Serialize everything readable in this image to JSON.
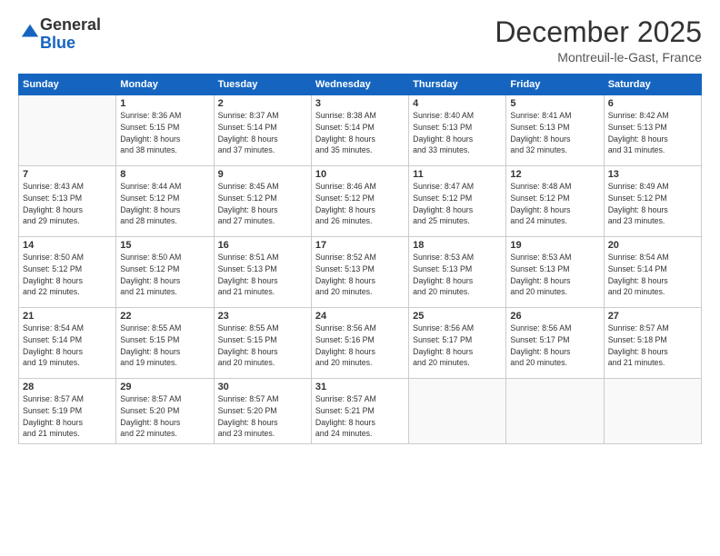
{
  "logo": {
    "general": "General",
    "blue": "Blue"
  },
  "header": {
    "month": "December 2025",
    "location": "Montreuil-le-Gast, France"
  },
  "weekdays": [
    "Sunday",
    "Monday",
    "Tuesday",
    "Wednesday",
    "Thursday",
    "Friday",
    "Saturday"
  ],
  "weeks": [
    [
      {
        "day": "",
        "info": ""
      },
      {
        "day": "1",
        "info": "Sunrise: 8:36 AM\nSunset: 5:15 PM\nDaylight: 8 hours\nand 38 minutes."
      },
      {
        "day": "2",
        "info": "Sunrise: 8:37 AM\nSunset: 5:14 PM\nDaylight: 8 hours\nand 37 minutes."
      },
      {
        "day": "3",
        "info": "Sunrise: 8:38 AM\nSunset: 5:14 PM\nDaylight: 8 hours\nand 35 minutes."
      },
      {
        "day": "4",
        "info": "Sunrise: 8:40 AM\nSunset: 5:13 PM\nDaylight: 8 hours\nand 33 minutes."
      },
      {
        "day": "5",
        "info": "Sunrise: 8:41 AM\nSunset: 5:13 PM\nDaylight: 8 hours\nand 32 minutes."
      },
      {
        "day": "6",
        "info": "Sunrise: 8:42 AM\nSunset: 5:13 PM\nDaylight: 8 hours\nand 31 minutes."
      }
    ],
    [
      {
        "day": "7",
        "info": "Sunrise: 8:43 AM\nSunset: 5:13 PM\nDaylight: 8 hours\nand 29 minutes."
      },
      {
        "day": "8",
        "info": "Sunrise: 8:44 AM\nSunset: 5:12 PM\nDaylight: 8 hours\nand 28 minutes."
      },
      {
        "day": "9",
        "info": "Sunrise: 8:45 AM\nSunset: 5:12 PM\nDaylight: 8 hours\nand 27 minutes."
      },
      {
        "day": "10",
        "info": "Sunrise: 8:46 AM\nSunset: 5:12 PM\nDaylight: 8 hours\nand 26 minutes."
      },
      {
        "day": "11",
        "info": "Sunrise: 8:47 AM\nSunset: 5:12 PM\nDaylight: 8 hours\nand 25 minutes."
      },
      {
        "day": "12",
        "info": "Sunrise: 8:48 AM\nSunset: 5:12 PM\nDaylight: 8 hours\nand 24 minutes."
      },
      {
        "day": "13",
        "info": "Sunrise: 8:49 AM\nSunset: 5:12 PM\nDaylight: 8 hours\nand 23 minutes."
      }
    ],
    [
      {
        "day": "14",
        "info": "Sunrise: 8:50 AM\nSunset: 5:12 PM\nDaylight: 8 hours\nand 22 minutes."
      },
      {
        "day": "15",
        "info": "Sunrise: 8:50 AM\nSunset: 5:12 PM\nDaylight: 8 hours\nand 21 minutes."
      },
      {
        "day": "16",
        "info": "Sunrise: 8:51 AM\nSunset: 5:13 PM\nDaylight: 8 hours\nand 21 minutes."
      },
      {
        "day": "17",
        "info": "Sunrise: 8:52 AM\nSunset: 5:13 PM\nDaylight: 8 hours\nand 20 minutes."
      },
      {
        "day": "18",
        "info": "Sunrise: 8:53 AM\nSunset: 5:13 PM\nDaylight: 8 hours\nand 20 minutes."
      },
      {
        "day": "19",
        "info": "Sunrise: 8:53 AM\nSunset: 5:13 PM\nDaylight: 8 hours\nand 20 minutes."
      },
      {
        "day": "20",
        "info": "Sunrise: 8:54 AM\nSunset: 5:14 PM\nDaylight: 8 hours\nand 20 minutes."
      }
    ],
    [
      {
        "day": "21",
        "info": "Sunrise: 8:54 AM\nSunset: 5:14 PM\nDaylight: 8 hours\nand 19 minutes."
      },
      {
        "day": "22",
        "info": "Sunrise: 8:55 AM\nSunset: 5:15 PM\nDaylight: 8 hours\nand 19 minutes."
      },
      {
        "day": "23",
        "info": "Sunrise: 8:55 AM\nSunset: 5:15 PM\nDaylight: 8 hours\nand 20 minutes."
      },
      {
        "day": "24",
        "info": "Sunrise: 8:56 AM\nSunset: 5:16 PM\nDaylight: 8 hours\nand 20 minutes."
      },
      {
        "day": "25",
        "info": "Sunrise: 8:56 AM\nSunset: 5:17 PM\nDaylight: 8 hours\nand 20 minutes."
      },
      {
        "day": "26",
        "info": "Sunrise: 8:56 AM\nSunset: 5:17 PM\nDaylight: 8 hours\nand 20 minutes."
      },
      {
        "day": "27",
        "info": "Sunrise: 8:57 AM\nSunset: 5:18 PM\nDaylight: 8 hours\nand 21 minutes."
      }
    ],
    [
      {
        "day": "28",
        "info": "Sunrise: 8:57 AM\nSunset: 5:19 PM\nDaylight: 8 hours\nand 21 minutes."
      },
      {
        "day": "29",
        "info": "Sunrise: 8:57 AM\nSunset: 5:20 PM\nDaylight: 8 hours\nand 22 minutes."
      },
      {
        "day": "30",
        "info": "Sunrise: 8:57 AM\nSunset: 5:20 PM\nDaylight: 8 hours\nand 23 minutes."
      },
      {
        "day": "31",
        "info": "Sunrise: 8:57 AM\nSunset: 5:21 PM\nDaylight: 8 hours\nand 24 minutes."
      },
      {
        "day": "",
        "info": ""
      },
      {
        "day": "",
        "info": ""
      },
      {
        "day": "",
        "info": ""
      }
    ]
  ]
}
